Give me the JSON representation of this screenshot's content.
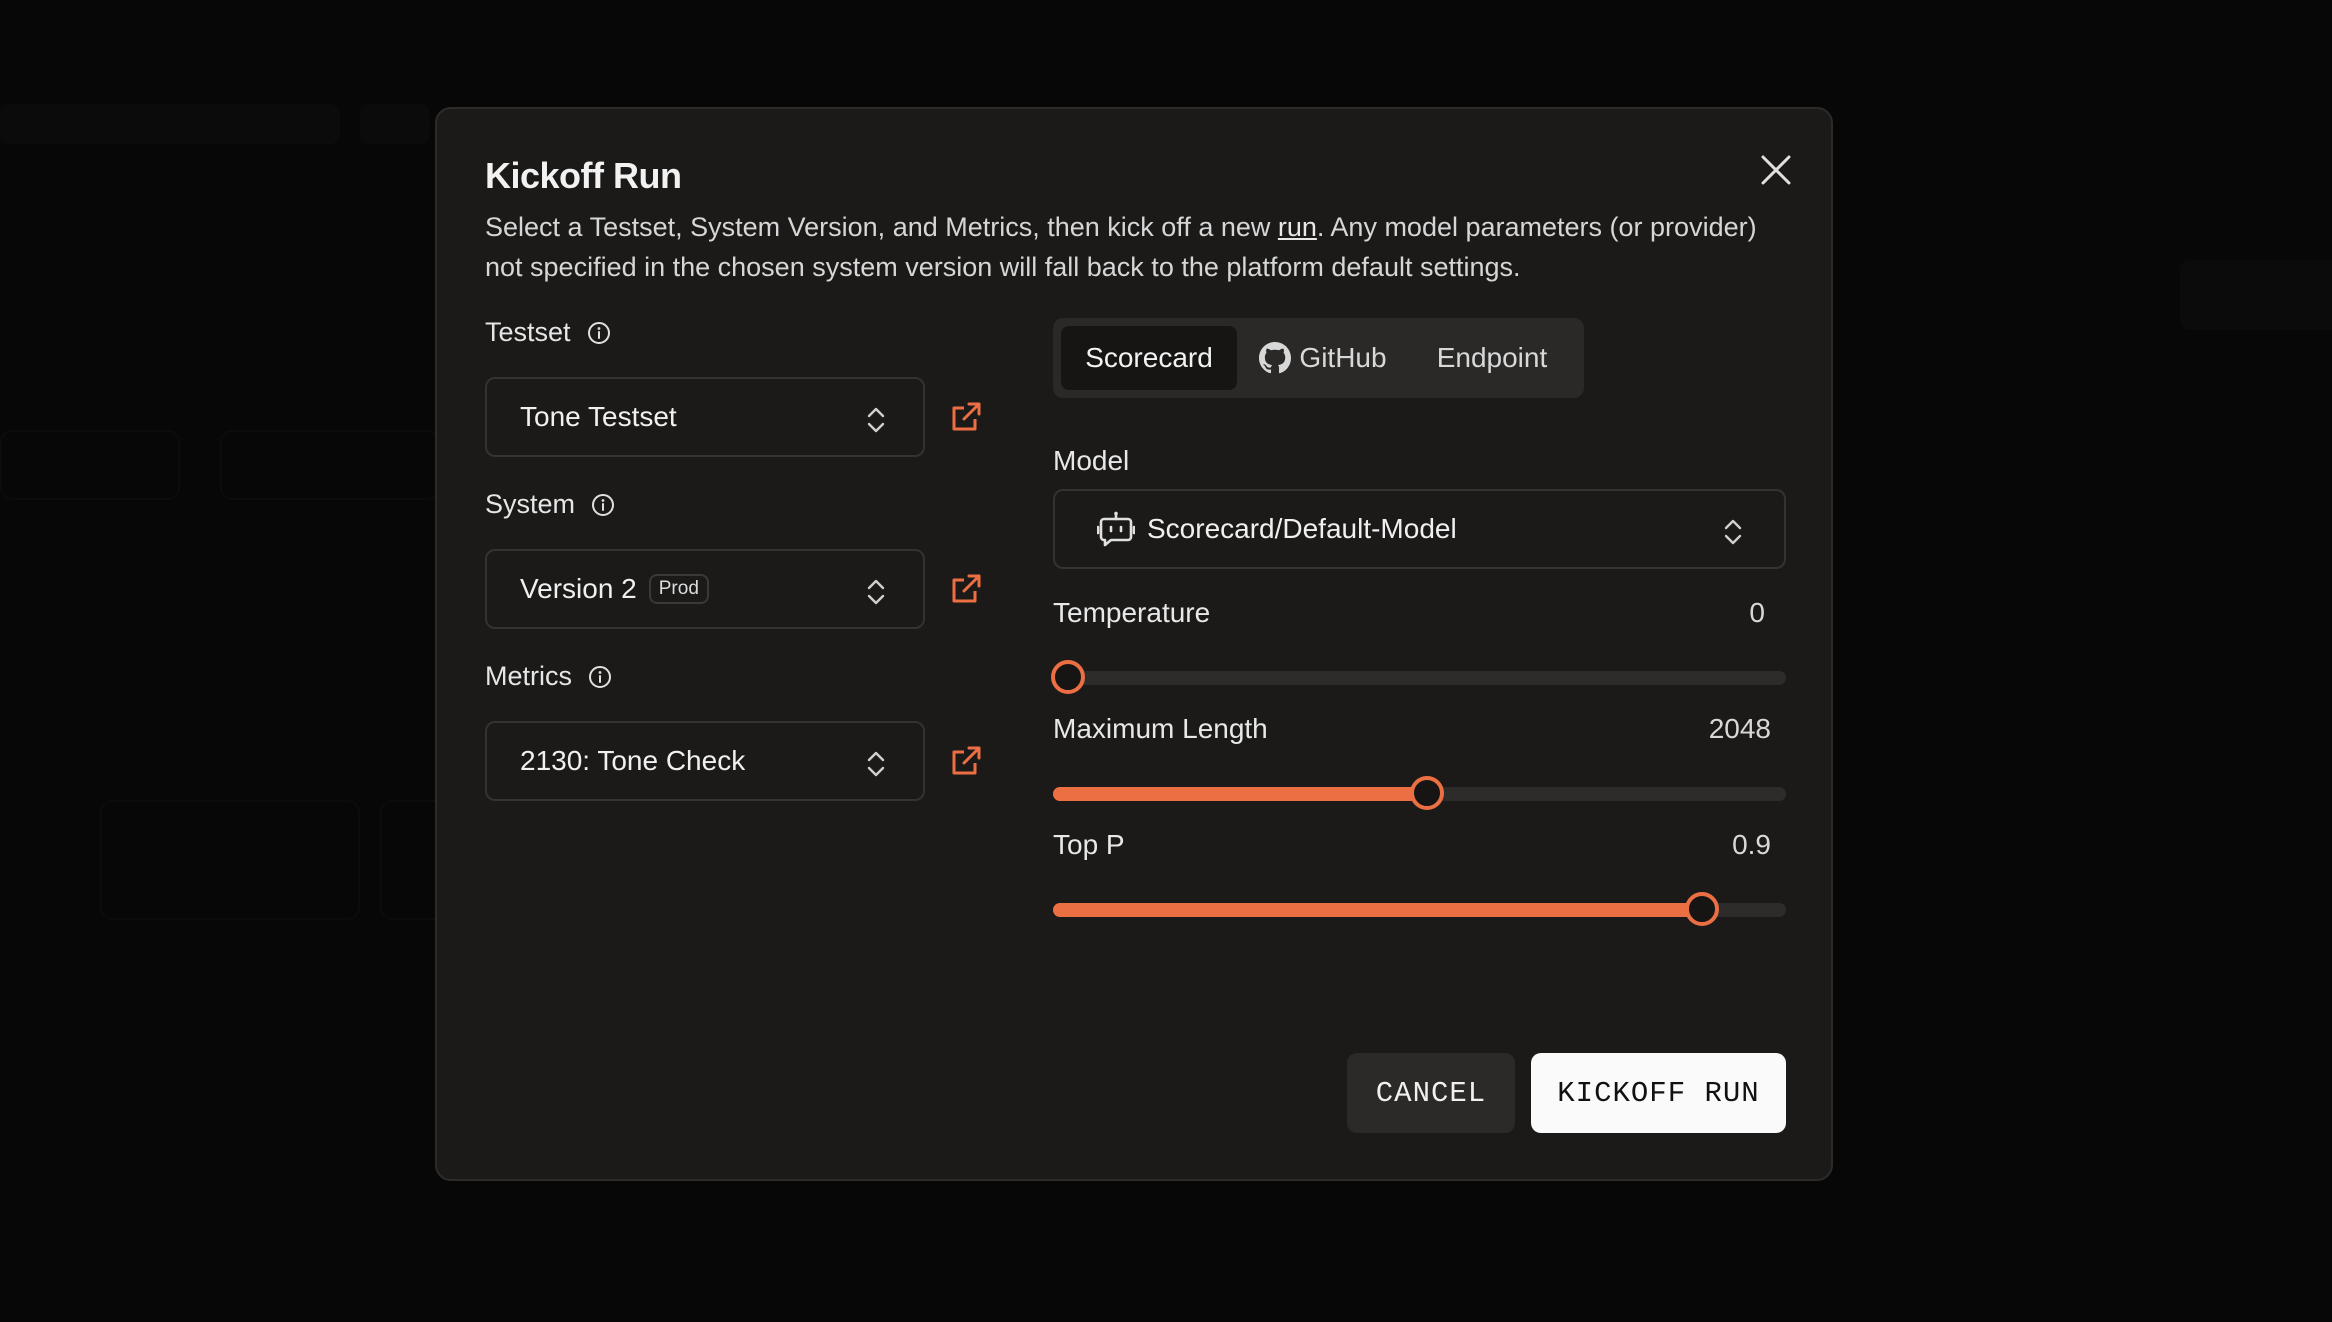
{
  "modal": {
    "title": "Kickoff Run",
    "desc_before": "Select a Testset, System Version, and Metrics, then kick off a new ",
    "desc_link": "run",
    "desc_after": ". Any model parameters (or provider) not specified in the chosen system version will fall back to the platform default settings."
  },
  "left": {
    "testset": {
      "label": "Testset",
      "value": "Tone Testset"
    },
    "system": {
      "label": "System",
      "value": "Version 2",
      "badge": "Prod"
    },
    "metrics": {
      "label": "Metrics",
      "value": "2130: Tone Check"
    }
  },
  "tabs": [
    {
      "label": "Scorecard",
      "active": true
    },
    {
      "label": "GitHub",
      "icon": "github-icon"
    },
    {
      "label": "Endpoint"
    }
  ],
  "model": {
    "label": "Model",
    "value": "Scorecard/Default-Model",
    "icon": "bot-icon"
  },
  "params": {
    "temperature": {
      "label": "Temperature",
      "value": "0",
      "fraction": 0.02
    },
    "max_length": {
      "label": "Maximum Length",
      "value": "2048",
      "fraction": 0.51
    },
    "top_p": {
      "label": "Top P",
      "value": "0.9",
      "fraction": 0.885
    }
  },
  "buttons": {
    "cancel": "CANCEL",
    "kickoff": "KICKOFF RUN"
  },
  "colors": {
    "accent": "#ec6f44",
    "modal_bg": "#1b1a19",
    "primary_button": "#fafafa"
  }
}
